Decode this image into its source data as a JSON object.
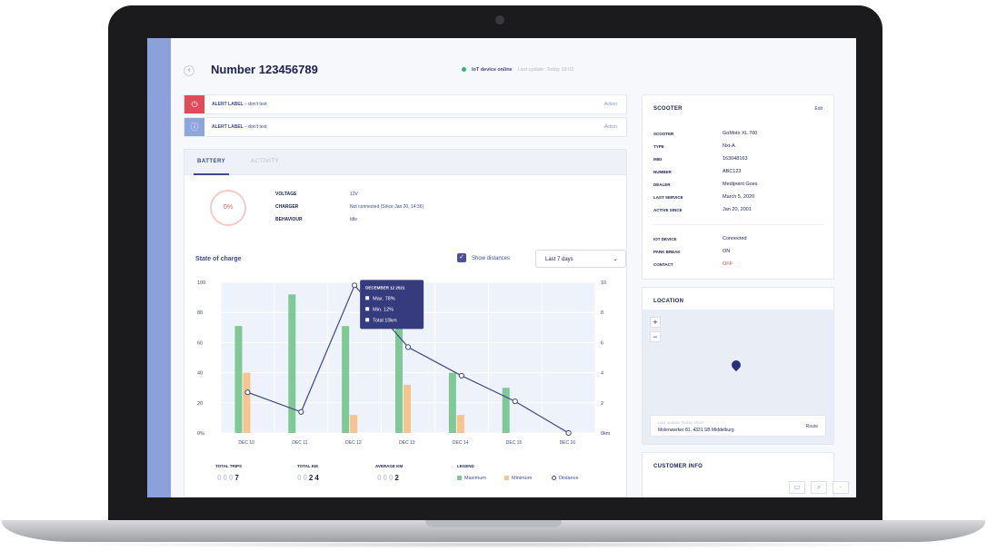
{
  "header": {
    "title": "Number 123456789",
    "status": "IoT device online",
    "last_update": "Last update: Today 18:03"
  },
  "alerts": [
    {
      "label": "ALERT LABEL",
      "text": "– don't text",
      "action": "Action",
      "color": "#e24a5a",
      "icon": "power-icon"
    },
    {
      "label": "ALERT LABEL",
      "text": "– don't text",
      "action": "Action",
      "color": "#8fa6dc",
      "icon": "info-icon"
    }
  ],
  "tabs": [
    "BATTERY",
    "ACTIVITY"
  ],
  "battery": {
    "gauge": "0%",
    "fields": [
      {
        "k": "VOLTAGE",
        "v": "12V"
      },
      {
        "k": "CHARGER",
        "v": "Not connected (Since Jan 20, 14:36)"
      },
      {
        "k": "BEHAVIOUR",
        "v": "Idle"
      }
    ]
  },
  "chart_controls": {
    "title": "State of charge",
    "toggle": "Show distances",
    "range": "Last 7 days"
  },
  "chart_data": {
    "type": "bar",
    "categories": [
      "DEC 10",
      "DEC 11",
      "DEC 12",
      "DEC 13",
      "DEC 14",
      "DEC 15",
      "DEC 16"
    ],
    "series": [
      {
        "name": "Maximum",
        "values": [
          71,
          92,
          71,
          78,
          40,
          30,
          0
        ]
      },
      {
        "name": "Minimum",
        "values": [
          40,
          0,
          12,
          32,
          12,
          0,
          0
        ]
      },
      {
        "name": "Distance",
        "values": [
          2.7,
          1.4,
          9.8,
          5.7,
          3.8,
          2.1,
          0
        ]
      }
    ],
    "ylim_left": [
      0,
      100
    ],
    "yticks_left": [
      "0%",
      "20",
      "40",
      "60",
      "80",
      "100"
    ],
    "ylim_right": [
      0,
      10
    ],
    "yticks_right": [
      "0km",
      "2",
      "4",
      "6",
      "8",
      "10"
    ],
    "tooltip": {
      "title": "DECEMBER 12 2021",
      "lines": [
        "Max. 78%",
        "Min. 12%",
        "Total 10km"
      ]
    },
    "colors": {
      "max": "#7fc996",
      "min": "#f5c48f",
      "line": "#3d4585",
      "plot_bg": "#eef2fa",
      "tooltip_bg": "#353b7d"
    }
  },
  "summary": [
    {
      "label": "TOTAL TRIPS",
      "digits": [
        "0",
        "0",
        "0",
        "7"
      ]
    },
    {
      "label": "TOTAL KM",
      "digits": [
        "0",
        "0",
        "2",
        "4"
      ]
    },
    {
      "label": "AVERAGE KM",
      "digits": [
        "0",
        "0",
        "0",
        "2"
      ]
    }
  ],
  "legend": {
    "title": "LEGEND",
    "items": [
      "Maximum",
      "Minimum",
      "Distance"
    ]
  },
  "scooter": {
    "title": "SCOOTER",
    "edit": "Edit",
    "rows": [
      {
        "k": "SCOOTER",
        "v": "GoMoto XL 700"
      },
      {
        "k": "TYPE",
        "v": "Nxt-A"
      },
      {
        "k": "IMEI",
        "v": "163048163"
      },
      {
        "k": "NUMBER",
        "v": "ABC123"
      },
      {
        "k": "DEALER",
        "v": "Medipoint Goes"
      },
      {
        "k": "LAST SERVICE",
        "v": "March 5, 2020"
      },
      {
        "k": "ACTIVE SINCE",
        "v": "Jan 20, 2001"
      }
    ],
    "rows2": [
      {
        "k": "IOT DEVICE",
        "v": "Connected"
      },
      {
        "k": "PARK BREAK",
        "v": "ON"
      },
      {
        "k": "CONTACT",
        "v": "OFF"
      }
    ]
  },
  "location": {
    "title": "LOCATION",
    "zoom_in": "+",
    "zoom_out": "−",
    "last_update": "Last update: Today 18:03",
    "address": "Molenwerker 81, 4331 SB Middelburg",
    "route": "Route"
  },
  "customer": {
    "title": "CUSTOMER INFO"
  }
}
